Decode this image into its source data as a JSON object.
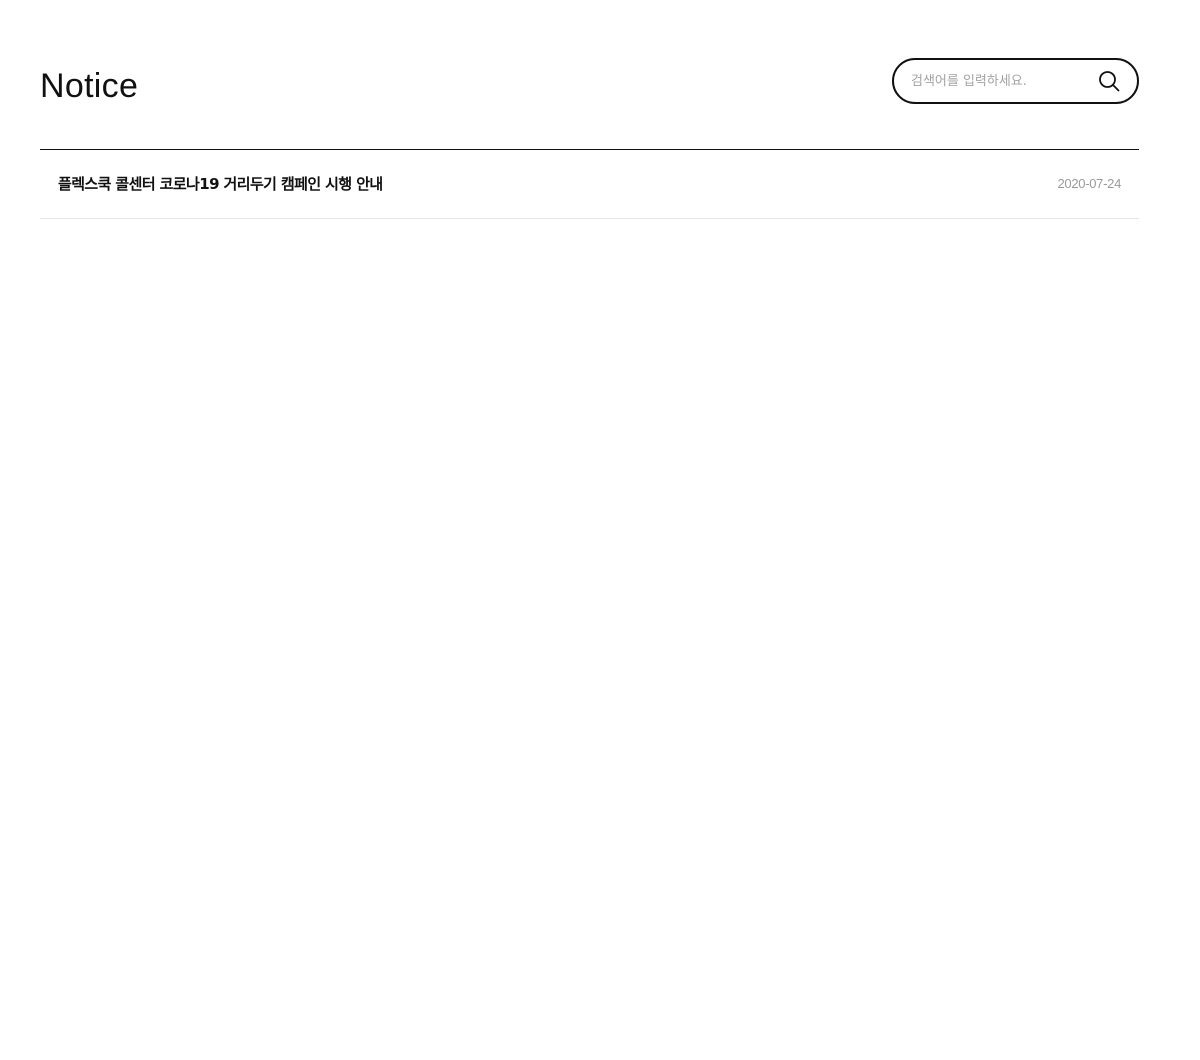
{
  "header": {
    "title": "Notice"
  },
  "search": {
    "placeholder": "검색어를 입력하세요.",
    "value": "",
    "icon": "search-icon"
  },
  "notices": [
    {
      "title": "플렉스쿡 콜센터 코로나19 거리두기 캠페인 시행 안내",
      "date": "2020-07-24"
    }
  ]
}
